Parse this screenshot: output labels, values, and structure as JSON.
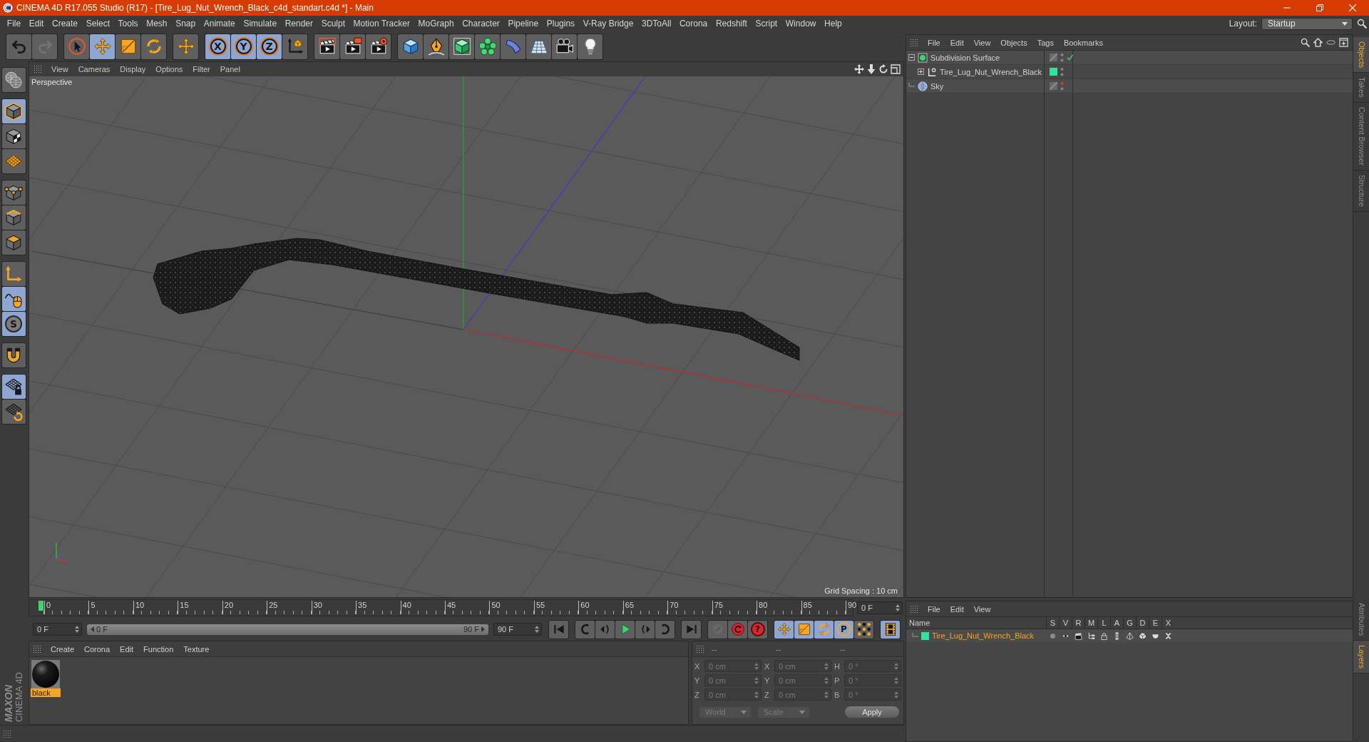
{
  "window": {
    "title": "CINEMA 4D R17.055 Studio (R17) - [Tire_Lug_Nut_Wrench_Black_c4d_standart.c4d *] - Main"
  },
  "menu_bar": {
    "items": [
      "File",
      "Edit",
      "Create",
      "Select",
      "Tools",
      "Mesh",
      "Snap",
      "Animate",
      "Simulate",
      "Render",
      "Sculpt",
      "Motion Tracker",
      "MoGraph",
      "Character",
      "Pipeline",
      "Plugins",
      "V-Ray Bridge",
      "3DToAll",
      "Corona",
      "Redshift",
      "Script",
      "Window",
      "Help"
    ],
    "layout_label": "Layout:",
    "layout_value": "Startup"
  },
  "toolbar": [
    [
      {
        "kind": "undo",
        "selected": false,
        "disabled": false
      },
      {
        "kind": "redo",
        "selected": false,
        "disabled": true
      }
    ],
    [
      {
        "kind": "select",
        "selected": false,
        "disabled": false
      },
      {
        "kind": "move",
        "selected": true,
        "disabled": false
      },
      {
        "kind": "scale",
        "selected": false,
        "disabled": false
      },
      {
        "kind": "rotate",
        "selected": false,
        "disabled": false
      }
    ],
    [
      {
        "kind": "recent",
        "selected": false,
        "disabled": false
      }
    ],
    [
      {
        "kind": "axis",
        "label": "X",
        "selected": true,
        "disabled": false
      },
      {
        "kind": "axis",
        "label": "Y",
        "selected": true,
        "disabled": false
      },
      {
        "kind": "axis",
        "label": "Z",
        "selected": true,
        "disabled": false
      },
      {
        "kind": "coordinates",
        "selected": false,
        "disabled": false
      }
    ],
    [
      {
        "kind": "render",
        "selected": false,
        "disabled": false
      },
      {
        "kind": "render-picture",
        "selected": false,
        "disabled": false
      },
      {
        "kind": "render-settings",
        "selected": false,
        "disabled": false
      }
    ],
    [
      {
        "kind": "cube",
        "selected": false,
        "disabled": false
      },
      {
        "kind": "pen",
        "selected": false,
        "disabled": false
      },
      {
        "kind": "subdivision",
        "selected": false,
        "disabled": false
      },
      {
        "kind": "cloner",
        "selected": false,
        "disabled": false
      },
      {
        "kind": "deformer",
        "selected": false,
        "disabled": false
      },
      {
        "kind": "floor",
        "selected": false,
        "disabled": false
      },
      {
        "kind": "camera",
        "selected": false,
        "disabled": false
      },
      {
        "kind": "light",
        "selected": false,
        "disabled": false
      }
    ]
  ],
  "mode_toolbar": [
    [
      {
        "kind": "make-editable",
        "selected": false,
        "disabled": false
      }
    ],
    [
      {
        "kind": "model",
        "selected": true,
        "disabled": false
      },
      {
        "kind": "texture",
        "selected": false,
        "disabled": false
      },
      {
        "kind": "workplane",
        "selected": false,
        "disabled": false
      }
    ],
    [
      {
        "kind": "points",
        "selected": false,
        "disabled": false
      },
      {
        "kind": "edges",
        "selected": false,
        "disabled": false
      },
      {
        "kind": "polygons",
        "selected": false,
        "disabled": false
      }
    ],
    [
      {
        "kind": "axis-mode",
        "selected": false,
        "disabled": false
      },
      {
        "kind": "tweak",
        "selected": true,
        "disabled": false
      },
      {
        "kind": "snap",
        "label": "S",
        "selected": true,
        "disabled": false
      }
    ],
    [
      {
        "kind": "magnet",
        "selected": false,
        "disabled": false
      }
    ],
    [
      {
        "kind": "grid-lock",
        "selected": true,
        "disabled": false
      },
      {
        "kind": "grid-rotate",
        "selected": false,
        "disabled": false
      }
    ]
  ],
  "logo": {
    "brand": "MAXON",
    "product": "CINEMA 4D"
  },
  "viewport": {
    "menu": [
      "View",
      "Cameras",
      "Display",
      "Options",
      "Filter",
      "Panel"
    ],
    "camera": "Perspective",
    "grid_spacing": "Grid Spacing : 10 cm"
  },
  "timeline": {
    "frames": [
      "0",
      "5",
      "10",
      "15",
      "20",
      "25",
      "30",
      "35",
      "40",
      "45",
      "50",
      "55",
      "60",
      "65",
      "70",
      "75",
      "80",
      "85",
      "90"
    ],
    "playhead": {
      "level": 0
    },
    "current_frame": "0 F"
  },
  "playback": {
    "start_field": "0 F",
    "range": {
      "start": "0 F",
      "end": "90 F",
      "level": 1
    },
    "end_field": "90 F",
    "buttons": [
      [
        {
          "kind": "go-start",
          "selected": false,
          "disabled": false
        }
      ],
      [
        {
          "kind": "prev-key",
          "selected": false,
          "disabled": false
        },
        {
          "kind": "prev-frame",
          "selected": false,
          "disabled": false
        },
        {
          "kind": "play",
          "selected": false,
          "disabled": false
        },
        {
          "kind": "next-frame",
          "selected": false,
          "disabled": false
        },
        {
          "kind": "next-key",
          "selected": false,
          "disabled": false
        }
      ],
      [
        {
          "kind": "go-end",
          "selected": false,
          "disabled": false
        }
      ],
      [
        {
          "kind": "record",
          "selected": false,
          "disabled": true
        },
        {
          "kind": "autokey",
          "selected": false,
          "disabled": false
        },
        {
          "kind": "key-selection",
          "label": "?",
          "selected": false,
          "disabled": false
        }
      ],
      [
        {
          "kind": "key-position",
          "selected": true,
          "disabled": false
        },
        {
          "kind": "key-scale",
          "selected": true,
          "disabled": false
        },
        {
          "kind": "key-rotation",
          "selected": true,
          "disabled": false
        },
        {
          "kind": "key-parameter",
          "label": "P",
          "selected": true,
          "disabled": false
        },
        {
          "kind": "key-pla",
          "selected": false,
          "disabled": false
        }
      ],
      [
        {
          "kind": "scheme",
          "selected": true,
          "disabled": false
        }
      ]
    ]
  },
  "material_manager": {
    "menu": [
      "Create",
      "Corona",
      "Edit",
      "Function",
      "Texture"
    ],
    "materials": [
      {
        "name": "black",
        "selected": true
      }
    ]
  },
  "coordinate_manager": {
    "headers": [
      "--",
      "--",
      "--"
    ],
    "rows": [
      [
        {
          "label": "X",
          "value": "0 cm"
        },
        {
          "label": "X",
          "value": "0 cm"
        },
        {
          "label": "H",
          "value": "0 °"
        }
      ],
      [
        {
          "label": "Y",
          "value": "0 cm"
        },
        {
          "label": "Y",
          "value": "0 cm"
        },
        {
          "label": "P",
          "value": "0 °"
        }
      ],
      [
        {
          "label": "Z",
          "value": "0 cm"
        },
        {
          "label": "Z",
          "value": "0 cm"
        },
        {
          "label": "B",
          "value": "0 °"
        }
      ]
    ],
    "mode": "World",
    "transform": "Scale",
    "apply": "Apply"
  },
  "object_manager": {
    "menu": [
      "File",
      "Edit",
      "View",
      "Objects",
      "Tags",
      "Bookmarks"
    ],
    "objects": [
      {
        "name": "Subdivision Surface",
        "kind": "subdivision",
        "expanded": true,
        "editor_visible": true,
        "enabled": true,
        "children": [
          {
            "name": "Tire_Lug_Nut_Wrench_Black",
            "kind": "null",
            "expanded": false,
            "editor_visible": true,
            "color": "#2ee59d"
          }
        ]
      },
      {
        "name": "Sky",
        "kind": "sky",
        "editor_visible": false
      }
    ]
  },
  "layer_manager": {
    "menu": [
      "File",
      "Edit",
      "View"
    ],
    "columns": [
      "Name",
      "S",
      "V",
      "R",
      "M",
      "L",
      "A",
      "G",
      "D",
      "E",
      "X"
    ],
    "layers": [
      {
        "name": "Tire_Lug_Nut_Wrench_Black",
        "color": "#2ee59d",
        "selected": true
      }
    ]
  },
  "side_tabs": {
    "top": [
      {
        "label": "Objects",
        "selected": true
      },
      {
        "label": "Takes",
        "selected": false
      },
      {
        "label": "Content Browser",
        "selected": false
      },
      {
        "label": "Structure",
        "selected": false
      }
    ],
    "bottom": [
      {
        "label": "Attributes",
        "selected": false
      },
      {
        "label": "Layers",
        "selected": true
      }
    ]
  }
}
